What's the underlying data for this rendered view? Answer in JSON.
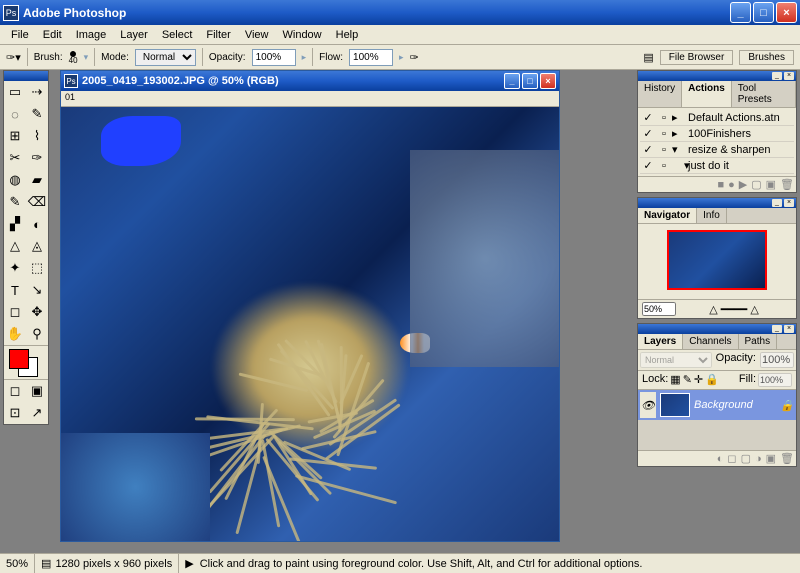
{
  "app": {
    "title": "Adobe Photoshop"
  },
  "menubar": [
    "File",
    "Edit",
    "Image",
    "Layer",
    "Select",
    "Filter",
    "View",
    "Window",
    "Help"
  ],
  "optbar": {
    "brush_label": "Brush:",
    "brush_size": "40",
    "mode_label": "Mode:",
    "mode_value": "Normal",
    "opacity_label": "Opacity:",
    "opacity_value": "100%",
    "flow_label": "Flow:",
    "flow_value": "100%",
    "tabs": [
      "File Browser",
      "Brushes"
    ]
  },
  "toolbox": {
    "tools": [
      "▭",
      "⇢",
      "◌",
      "✎",
      "⊞",
      "⌇",
      "✂",
      "✑",
      "◍",
      "▰",
      "✎",
      "⌫",
      "▞",
      "◐",
      "△",
      "◬",
      "✦",
      "⬚",
      "T",
      "↘",
      "◻",
      "✥",
      "✋",
      "⚲"
    ],
    "names": [
      "rect-marquee-tool",
      "move-tool",
      "lasso-tool",
      "magic-wand-tool",
      "crop-tool",
      "slice-tool",
      "healing-brush-tool",
      "brush-tool",
      "clone-stamp-tool",
      "history-brush-tool",
      "pencil-tool",
      "eraser-tool",
      "gradient-tool",
      "blur-tool",
      "dodge-tool",
      "path-selection-tool",
      "pen-tool",
      "custom-shape-tool",
      "type-tool",
      "line-tool",
      "rectangle-tool",
      "notes-tool",
      "hand-tool",
      "zoom-tool"
    ],
    "fg_color": "#ff0000",
    "bg_color": "#ffffff",
    "bottom": [
      "◻",
      "▣",
      "⊡",
      "↗"
    ]
  },
  "document": {
    "title": "2005_0419_193002.JPG @ 50% (RGB)",
    "info": "01"
  },
  "actions_panel": {
    "tabs": [
      "History",
      "Actions",
      "Tool Presets"
    ],
    "rows": [
      {
        "checked": true,
        "icon": "▸",
        "label": "Default Actions.atn"
      },
      {
        "checked": true,
        "icon": "▸",
        "label": "100Finishers"
      },
      {
        "checked": true,
        "icon": "▾",
        "label": "resize & sharpen"
      },
      {
        "checked": true,
        "icon": "▾",
        "label": "just do it",
        "indent": true
      }
    ]
  },
  "navigator_panel": {
    "tabs": [
      "Navigator",
      "Info"
    ],
    "zoom": "50%"
  },
  "layers_panel": {
    "tabs": [
      "Layers",
      "Channels",
      "Paths"
    ],
    "blend_mode": "Normal",
    "opacity_label": "Opacity:",
    "opacity": "100%",
    "lock_label": "Lock:",
    "fill_label": "Fill:",
    "fill": "100%",
    "layer": {
      "name": "Background",
      "locked": true
    }
  },
  "statusbar": {
    "zoom": "50%",
    "dims": "1280 pixels x 960 pixels",
    "hint": "Click and drag to paint using foreground color.  Use Shift, Alt, and Ctrl for additional options."
  }
}
